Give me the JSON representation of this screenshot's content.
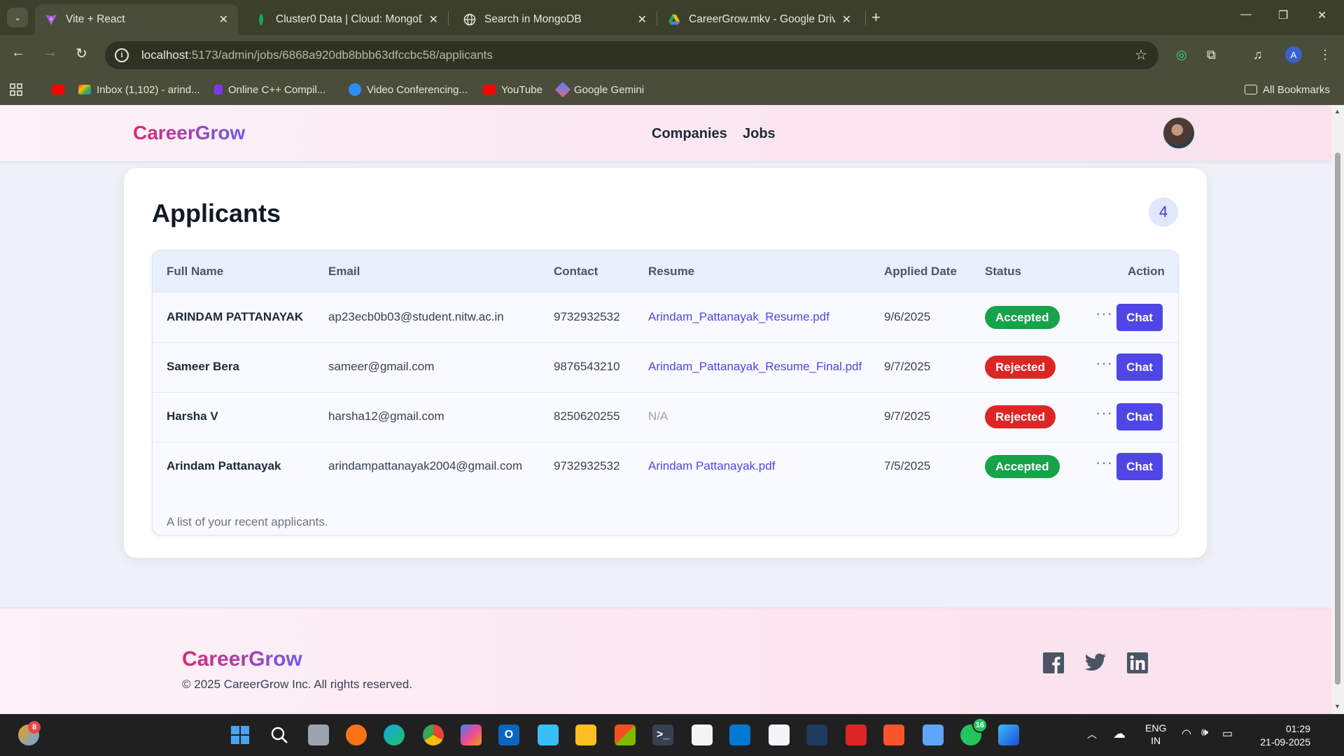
{
  "browser": {
    "tabs": [
      {
        "title": "Vite + React",
        "active": true
      },
      {
        "title": "Cluster0 Data | Cloud: MongoDB"
      },
      {
        "title": "Search in MongoDB"
      },
      {
        "title": "CareerGrow.mkv - Google Drive"
      }
    ],
    "url_host": "localhost",
    "url_path": ":5173/admin/jobs/6868a920db8bbb63dfccbc58/applicants",
    "profile_initial": "A",
    "bookmarks": [
      "Inbox (1,102) - arind...",
      "Online C++ Compil...",
      "Video Conferencing...",
      "YouTube",
      "Google Gemini"
    ],
    "all_bookmarks": "All Bookmarks"
  },
  "site": {
    "brand": "CareerGrow",
    "nav": [
      "Companies",
      "Jobs"
    ]
  },
  "applicants": {
    "heading": "Applicants",
    "count": "4",
    "columns": [
      "Full Name",
      "Email",
      "Contact",
      "Resume",
      "Applied Date",
      "Status",
      "Action"
    ],
    "rows": [
      {
        "name": "ARINDAM PATTANAYAK",
        "email": "ap23ecb0b03@student.nitw.ac.in",
        "contact": "9732932532",
        "resume": "Arindam_Pattanayak_Resume.pdf",
        "date": "9/6/2025",
        "status": "Accepted",
        "action": "Chat"
      },
      {
        "name": "Sameer Bera",
        "email": "sameer@gmail.com",
        "contact": "9876543210",
        "resume": "Arindam_Pattanayak_Resume_Final.pdf",
        "date": "9/7/2025",
        "status": "Rejected",
        "action": "Chat"
      },
      {
        "name": "Harsha V",
        "email": "harsha12@gmail.com",
        "contact": "8250620255",
        "resume": "N/A",
        "date": "9/7/2025",
        "status": "Rejected",
        "action": "Chat"
      },
      {
        "name": "Arindam Pattanayak",
        "email": "arindampattanayak2004@gmail.com",
        "contact": "9732932532",
        "resume": "Arindam Pattanayak.pdf",
        "date": "7/5/2025",
        "status": "Accepted",
        "action": "Chat"
      }
    ],
    "caption": "A list of your recent applicants."
  },
  "footer": {
    "brand": "CareerGrow",
    "copyright": "© 2025 CareerGrow Inc. All rights reserved.",
    "social": [
      "facebook-icon",
      "twitter-icon",
      "linkedin-icon"
    ]
  },
  "taskbar": {
    "widgets_badge": "8",
    "whatsapp_badge": "16",
    "lang_1": "ENG",
    "lang_2": "IN",
    "time": "01:29",
    "date": "21-09-2025"
  },
  "colors": {
    "accent": "#4f46e5",
    "accepted": "#16a34a",
    "rejected": "#dc2626",
    "brand_pink": "#db2777",
    "brand_purple": "#6d5ce8"
  }
}
